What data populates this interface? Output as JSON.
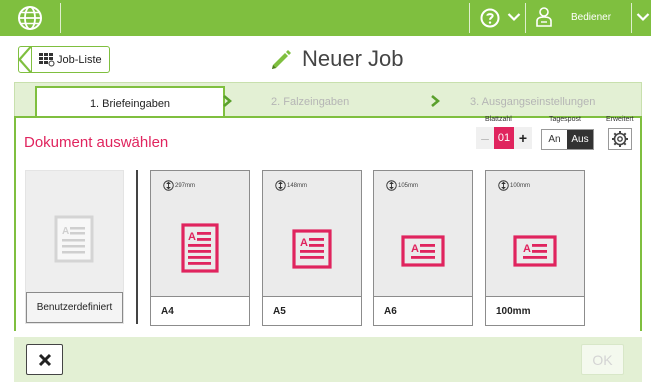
{
  "header": {
    "globe_icon": "globe-icon",
    "help_icon": "help-icon",
    "user_icon": "user-icon",
    "user_label": "Bediener",
    "accent_color": "#7fbf3f"
  },
  "nav": {
    "back_label": "Job-Liste",
    "title": "Neuer Job"
  },
  "steps": [
    {
      "label": "1. Briefeingaben",
      "active": true
    },
    {
      "label": "2. Falzeingaben",
      "active": false
    },
    {
      "label": "3. Ausgangseinstellungen",
      "active": false
    }
  ],
  "main": {
    "section_title": "Dokument auswählen",
    "highlight_color": "#e0245e"
  },
  "controls": {
    "sheet_count_label": "Blattzahl",
    "sheet_count_minus": "–",
    "sheet_count_value": "01",
    "sheet_count_plus": "+",
    "daily_mail_label": "Tagespost",
    "daily_mail_on": "An",
    "daily_mail_off": "Aus",
    "daily_mail_selected": "Aus",
    "advanced_label": "Erweitert"
  },
  "documents": {
    "custom_label": "Benutzerdefiniert",
    "cards": [
      {
        "label": "A4",
        "dimension": "297mm"
      },
      {
        "label": "A5",
        "dimension": "148mm"
      },
      {
        "label": "A6",
        "dimension": "105mm"
      },
      {
        "label": "100mm",
        "dimension": "100mm"
      }
    ]
  },
  "footer": {
    "cancel_icon": "close-icon",
    "ok_label": "OK"
  }
}
